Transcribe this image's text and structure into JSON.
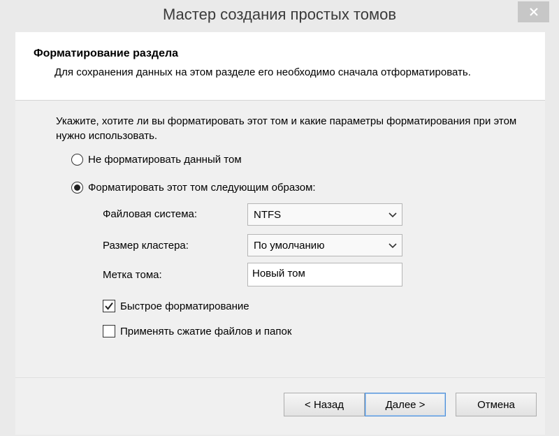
{
  "window": {
    "title": "Мастер создания простых томов"
  },
  "header": {
    "title": "Форматирование раздела",
    "description": "Для сохранения данных на этом разделе его необходимо сначала отформатировать."
  },
  "content": {
    "instruction": "Укажите, хотите ли вы форматировать этот том и какие параметры форматирования при этом нужно использовать.",
    "radio_no_format": {
      "label": "Не форматировать данный том",
      "checked": false
    },
    "radio_format": {
      "label": "Форматировать этот том следующим образом:",
      "checked": true
    },
    "file_system": {
      "label": "Файловая система:",
      "value": "NTFS"
    },
    "cluster_size": {
      "label": "Размер кластера:",
      "value": "По умолчанию"
    },
    "volume_label": {
      "label": "Метка тома:",
      "value": "Новый том"
    },
    "quick_format": {
      "label": "Быстрое форматирование",
      "checked": true
    },
    "compression": {
      "label": "Применять сжатие файлов и папок",
      "checked": false
    }
  },
  "footer": {
    "back_label": "< Назад",
    "next_label": "Далее >",
    "cancel_label": "Отмена"
  },
  "icons": {
    "close": "close-icon",
    "dropdown": "chevron-down-icon",
    "check": "checkmark-icon"
  },
  "colors": {
    "header_bg": "#ffffff",
    "body_bg": "#f0f0f0",
    "primary_border": "#4f8fd6"
  }
}
